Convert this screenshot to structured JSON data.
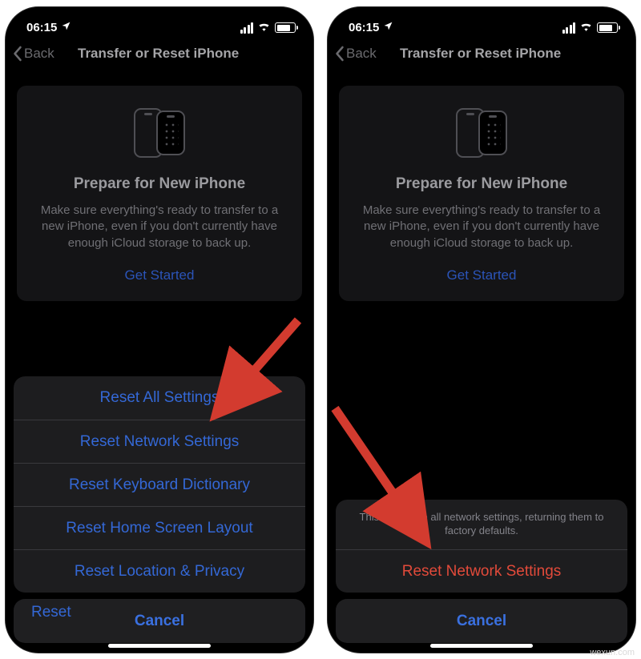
{
  "status": {
    "time": "06:15"
  },
  "nav": {
    "back": "Back",
    "title": "Transfer or Reset iPhone"
  },
  "card": {
    "heading": "Prepare for New iPhone",
    "body": "Make sure everything's ready to transfer to a new iPhone, even if you don't currently have enough iCloud storage to back up.",
    "cta": "Get Started"
  },
  "left_sheet": {
    "items": [
      "Reset All Settings",
      "Reset Network Settings",
      "Reset Keyboard Dictionary",
      "Reset Home Screen Layout",
      "Reset Location & Privacy"
    ],
    "cancel": "Cancel",
    "peek": "Reset"
  },
  "right_sheet": {
    "message": "This will delete all network settings, returning them to factory defaults.",
    "confirm": "Reset Network Settings",
    "cancel": "Cancel"
  },
  "colors": {
    "link": "#3468d6",
    "destructive": "#e24a3a",
    "arrow": "#d33b2f"
  },
  "watermark": "wexun.com"
}
